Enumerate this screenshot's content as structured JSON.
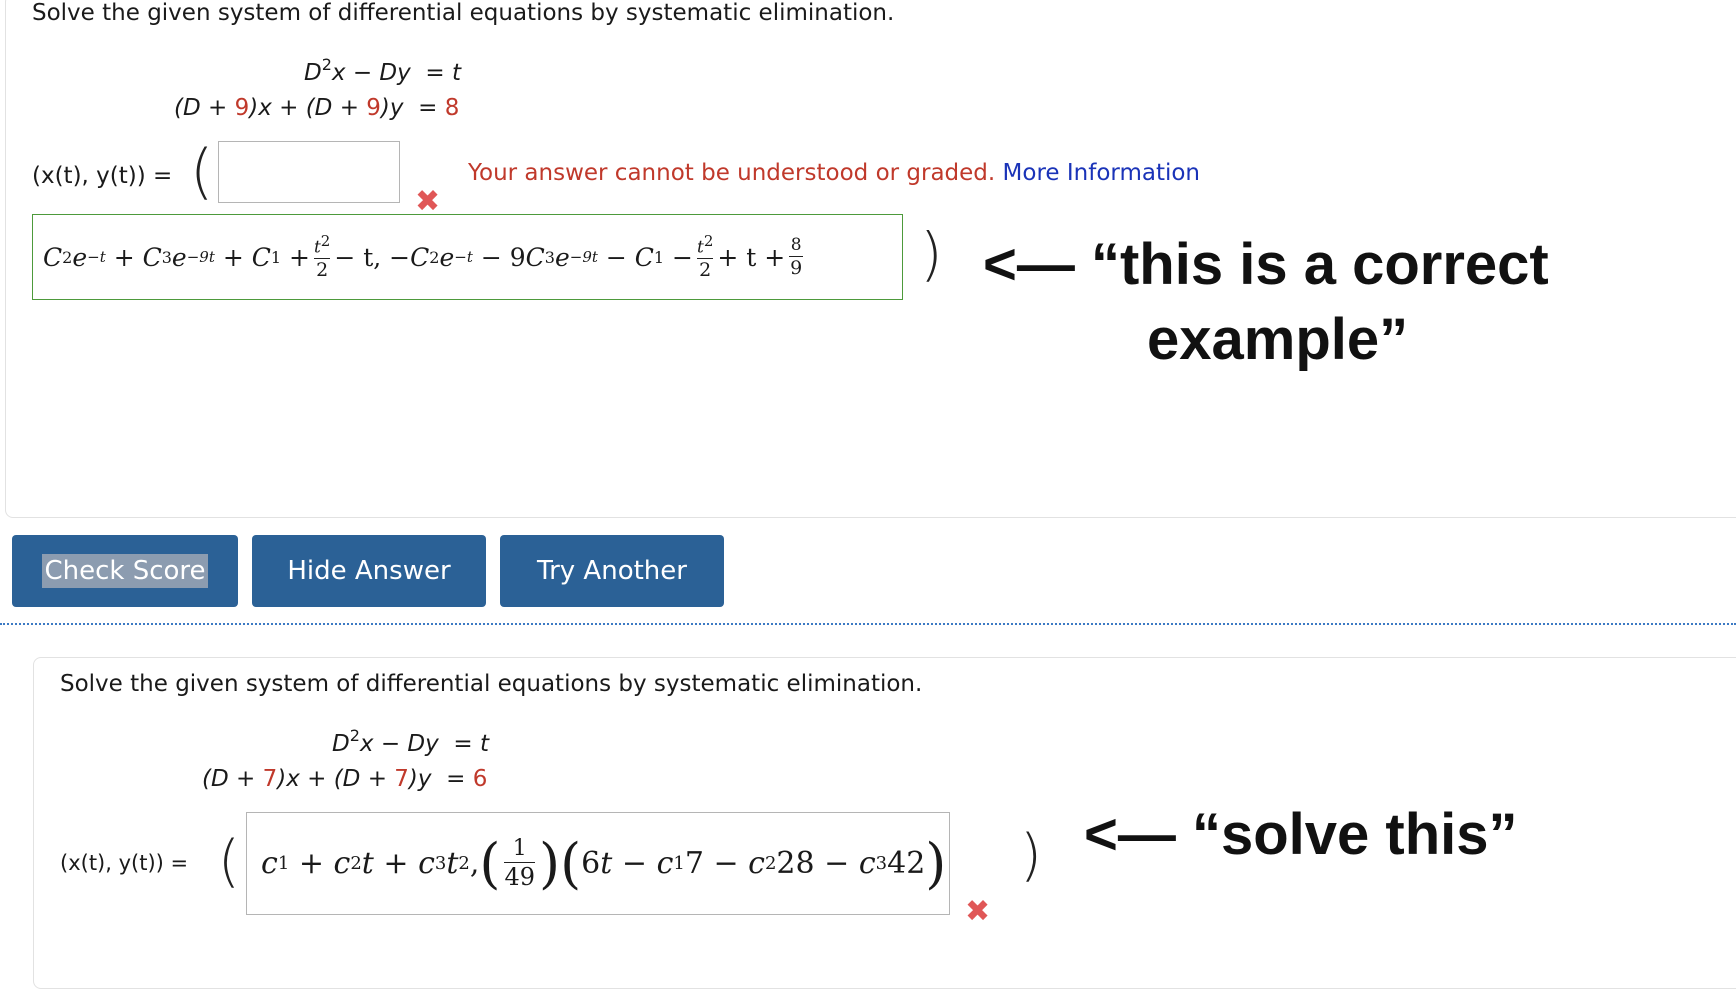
{
  "problem1": {
    "prompt": "Solve the given system of differential equations by systematic elimination.",
    "eq1": {
      "lhs_a": "D",
      "lhs_sup": "2",
      "lhs_b": "x − Dy",
      "eq": "=",
      "rhs": "t"
    },
    "eq2": {
      "p1": "(D + ",
      "c1": "9",
      "p2": ")x + (D + ",
      "c2": "9",
      "p3": ")y",
      "eq": "=",
      "rhs": "8"
    },
    "answer_label": "(x(t), y(t)) =",
    "input_value": "",
    "error_text": "Your answer cannot be understood or graded.",
    "more_info_link": "More Information",
    "correct_answer": {
      "t1": "C",
      "t1s": "2",
      "t1e": "e",
      "t1x": "−t",
      "plus1": "+",
      "t2": "C",
      "t2s": "3",
      "t2e": "e",
      "t2x": "−9t",
      "plus2": "+",
      "t3": "C",
      "t3s": "1",
      "plus3": "+",
      "f1n": "t",
      "f1nsup": "2",
      "f1d": "2",
      "minus1": "− t, −",
      "t4": "C",
      "t4s": "2",
      "t4e": "e",
      "t4x": "−t",
      "minus2": "− 9",
      "t5": "C",
      "t5s": "3",
      "t5e": "e",
      "t5x": "−9t",
      "minus3": "−",
      "t6": "C",
      "t6s": "1",
      "minus4": "−",
      "f2n": "t",
      "f2nsup": "2",
      "f2d": "2",
      "plus4": "+ t +",
      "f3n": "8",
      "f3d": "9"
    }
  },
  "annotation1": {
    "line1": "<— “this is a correct",
    "line2": "example”"
  },
  "buttons": {
    "check_score": "Check Score",
    "hide_answer": "Hide Answer",
    "try_another": "Try Another"
  },
  "problem2": {
    "prompt": "Solve the given system of differential equations by systematic elimination.",
    "eq1": {
      "lhs_a": "D",
      "lhs_sup": "2",
      "lhs_b": "x − Dy",
      "eq": "=",
      "rhs": "t"
    },
    "eq2": {
      "p1": "(D + ",
      "c1": "7",
      "p2": ")x + (D + ",
      "c2": "7",
      "p3": ")y",
      "eq": "=",
      "rhs": "6"
    },
    "answer_label": "(x(t), y(t)) =",
    "entered_answer": {
      "c1": "c",
      "c1s": "1",
      "plus1": "+",
      "c2": "c",
      "c2s": "2",
      "t1": "t",
      "plus2": "+",
      "c3": "c",
      "c3s": "3",
      "t2": "t",
      "t2sup": "2",
      "comma": ",",
      "fn": "1",
      "fd": "49",
      "inner_a": "6",
      "inner_t": "t",
      "minus1": "−",
      "c4": "c",
      "c4s": "1",
      "v1": "7",
      "minus2": "−",
      "c5": "c",
      "c5s": "2",
      "v2": "28",
      "minus3": "−",
      "c6": "c",
      "c6s": "3",
      "v3": "42"
    }
  },
  "annotation2": {
    "text": "<— “solve this”"
  }
}
